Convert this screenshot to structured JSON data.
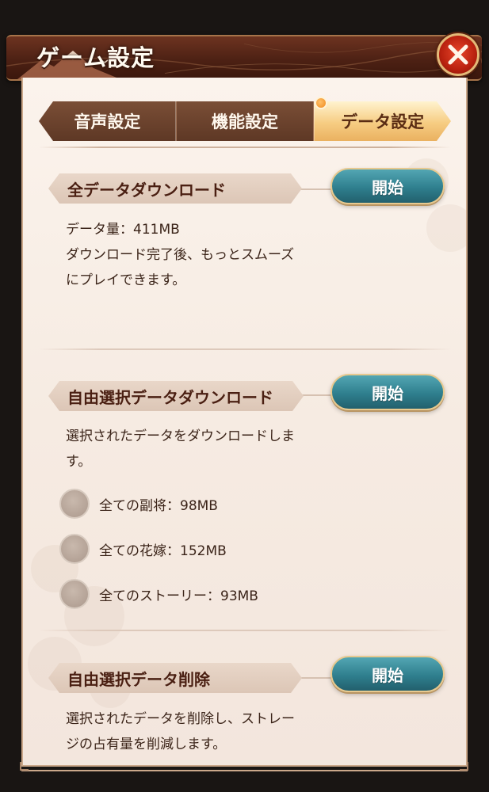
{
  "header": {
    "title": "ゲーム設定"
  },
  "tabs": [
    {
      "label": "音声設定",
      "active": false
    },
    {
      "label": "機能設定",
      "active": false,
      "badge": true
    },
    {
      "label": "データ設定",
      "active": true
    }
  ],
  "sections": {
    "all_download": {
      "label": "全データダウンロード",
      "button": "開始",
      "desc_lines": [
        "データ量：411MB",
        "ダウンロード完了後、もっとスムーズ",
        "にプレイできます。"
      ]
    },
    "select_download": {
      "label": "自由選択データダウンロード",
      "button": "開始",
      "desc_lines": [
        "選択されたデータをダウンロードしま",
        "す。"
      ],
      "options": [
        {
          "label": "全ての副将：98MB",
          "checked": false
        },
        {
          "label": "全ての花嫁：152MB",
          "checked": false
        },
        {
          "label": "全てのストーリー：93MB",
          "checked": false
        }
      ]
    },
    "select_delete": {
      "label": "自由選択データ削除",
      "button": "開始",
      "desc_lines": [
        "選択されたデータを削除し、ストレー",
        "ジの占有量を削減します。"
      ]
    }
  },
  "colors": {
    "header_bg": "#4d2114",
    "panel_bg": "#f6ebe2",
    "button_teal": "#2f7f8e",
    "tab_active": "#f6cc82",
    "close_red": "#b9210f"
  },
  "icons": {
    "close": "close-icon",
    "mountain": "mountain-icon",
    "birds": "birds-icon"
  }
}
